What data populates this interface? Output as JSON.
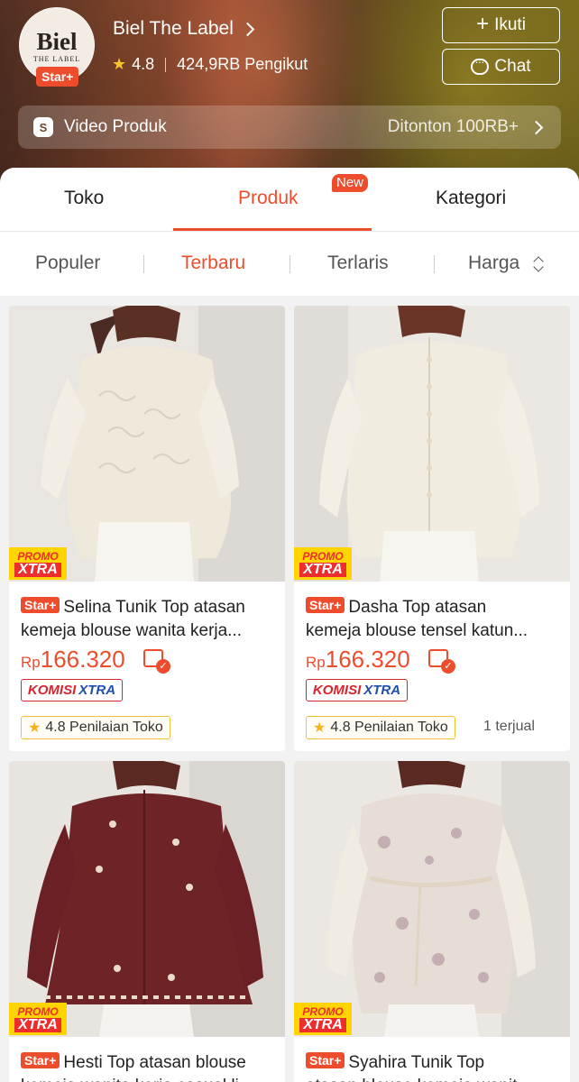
{
  "shop": {
    "logo_text": "Biel",
    "logo_sub": "THE LABEL",
    "badge": "Star+",
    "name": "Biel The Label",
    "rating": "4.8",
    "followers": "424,9RB Pengikut",
    "follow_label": "Ikuti",
    "chat_label": "Chat"
  },
  "video": {
    "icon": "S",
    "label": "Video Produk",
    "views": "Ditonton 100RB+"
  },
  "tabs": {
    "items": [
      {
        "label": "Toko"
      },
      {
        "label": "Produk"
      },
      {
        "label": "Kategori"
      }
    ],
    "active": "Produk",
    "new_badge": "New"
  },
  "sort": {
    "items": [
      {
        "label": "Populer"
      },
      {
        "label": "Terbaru"
      },
      {
        "label": "Terlaris"
      },
      {
        "label": "Harga"
      }
    ],
    "active": "Terbaru"
  },
  "products": [
    {
      "badge": "Star+",
      "title_line1": "Selina Tunik Top atasan",
      "title_line2": "kemeja blouse wanita kerja...",
      "price_currency": "Rp",
      "price": "166.320",
      "promo_top": "PROMO",
      "promo_bottom": "XTRA",
      "komisi_a": "KOMISI",
      "komisi_b": "XTRA",
      "rating_label": "4.8 Penilaian Toko",
      "sold": "",
      "color": "#efe9dc"
    },
    {
      "badge": "Star+",
      "title_line1": "Dasha Top atasan",
      "title_line2": "kemeja blouse tensel katun...",
      "price_currency": "Rp",
      "price": "166.320",
      "promo_top": "PROMO",
      "promo_bottom": "XTRA",
      "komisi_a": "KOMISI",
      "komisi_b": "XTRA",
      "rating_label": "4.8 Penilaian Toko",
      "sold": "1 terjual",
      "color": "#f1ece0"
    },
    {
      "badge": "Star+",
      "title_line1": "Hesti Top atasan blouse",
      "title_line2": "kemeja wanita kerja casual li...",
      "promo_top": "PROMO",
      "promo_bottom": "XTRA",
      "color": "#6e2327"
    },
    {
      "badge": "Star+",
      "title_line1": "Syahira Tunik Top",
      "title_line2": "atasan blouse kemeja wanit...",
      "promo_top": "PROMO",
      "promo_bottom": "XTRA",
      "color": "#e7ddd7"
    }
  ]
}
